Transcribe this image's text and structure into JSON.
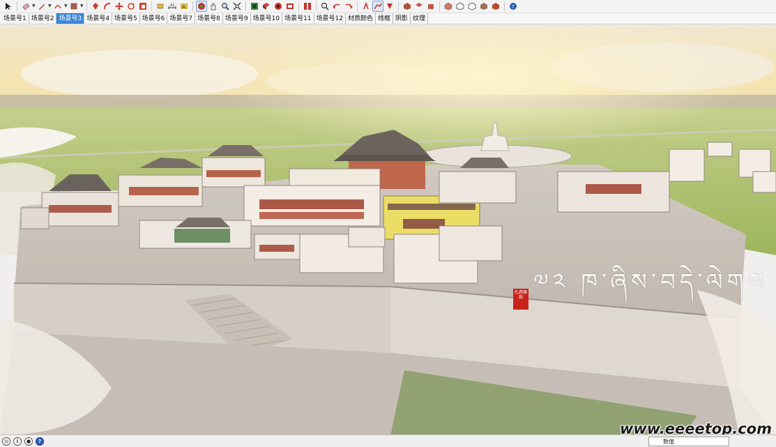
{
  "scene_tabs": [
    {
      "label": "场景号1",
      "active": false
    },
    {
      "label": "场景号2",
      "active": false
    },
    {
      "label": "场景号3",
      "active": true
    },
    {
      "label": "场景号4",
      "active": false
    },
    {
      "label": "场景号5",
      "active": false
    },
    {
      "label": "场景号6",
      "active": false
    },
    {
      "label": "场景号7",
      "active": false
    },
    {
      "label": "场景号8",
      "active": false
    },
    {
      "label": "场景号9",
      "active": false
    },
    {
      "label": "场景号10",
      "active": false
    },
    {
      "label": "场景号11",
      "active": false
    },
    {
      "label": "场景号12",
      "active": false
    },
    {
      "label": "材质颜色",
      "active": false
    },
    {
      "label": "线框",
      "active": false
    },
    {
      "label": "阴影",
      "active": false
    },
    {
      "label": "纹理",
      "active": false
    }
  ],
  "viewport": {
    "title_text": "༧༢ ཁ་ཞིས་བདེ་ལེགས",
    "seal_text": "扎西德勒",
    "watermark": "www.eeeetop.com"
  },
  "statusbar": {
    "measure_label": "数值"
  },
  "colors": {
    "active_tab": "#3a86d6",
    "seal": "#c8231c",
    "grass": "#9fb84a",
    "sky_glow": "#f6e6b0"
  }
}
